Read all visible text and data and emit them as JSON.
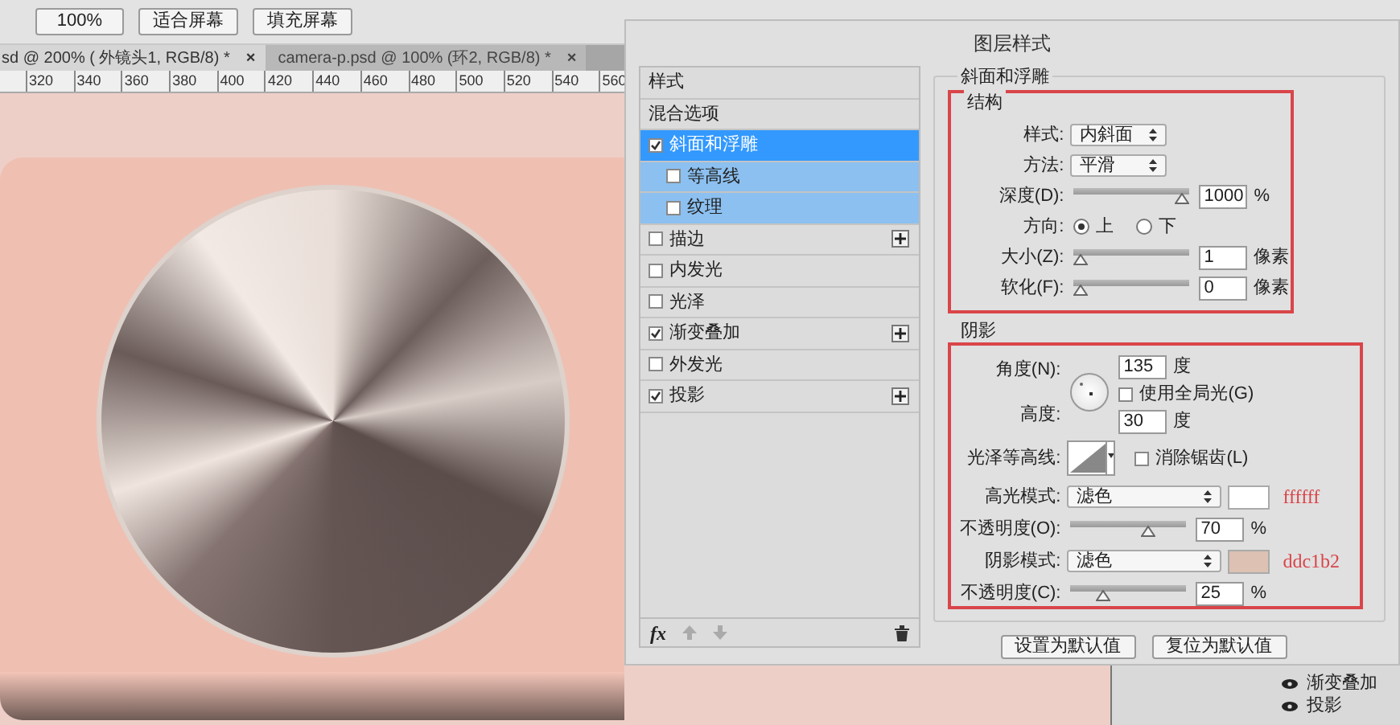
{
  "toolbar": {
    "buttons": [
      "100%",
      "适合屏幕",
      "填充屏幕"
    ]
  },
  "document_tabs": [
    {
      "label": "sd @ 200% ( 外镜头1, RGB/8) *",
      "close": "×",
      "selected": true
    },
    {
      "label": "camera-p.psd @ 100% (环2, RGB/8) *",
      "close": "×",
      "selected": false
    }
  ],
  "ruler": {
    "ticks": [
      "320",
      "340",
      "360",
      "380",
      "400",
      "420",
      "440",
      "460",
      "480",
      "500",
      "520",
      "540",
      "560"
    ]
  },
  "dialog": {
    "title": "图层样式",
    "styles_list": {
      "header": "样式",
      "blending": "混合选项",
      "items": [
        {
          "label": "斜面和浮雕",
          "checked": true,
          "selected": true,
          "kind": "effect",
          "add": false
        },
        {
          "label": "等高线",
          "checked": false,
          "selected": false,
          "kind": "sub",
          "add": false
        },
        {
          "label": "纹理",
          "checked": false,
          "selected": false,
          "kind": "sub",
          "add": false
        },
        {
          "label": "描边",
          "checked": false,
          "selected": false,
          "kind": "effect",
          "add": true
        },
        {
          "label": "内发光",
          "checked": false,
          "selected": false,
          "kind": "effect",
          "add": false
        },
        {
          "label": "光泽",
          "checked": false,
          "selected": false,
          "kind": "effect",
          "add": false
        },
        {
          "label": "渐变叠加",
          "checked": true,
          "selected": false,
          "kind": "effect",
          "add": true
        },
        {
          "label": "外发光",
          "checked": false,
          "selected": false,
          "kind": "effect",
          "add": false
        },
        {
          "label": "投影",
          "checked": true,
          "selected": false,
          "kind": "effect",
          "add": true
        }
      ],
      "footer_label": "fx"
    },
    "bevel": {
      "title": "斜面和浮雕",
      "structure_title": "结构",
      "style": {
        "label": "样式:",
        "value": "内斜面"
      },
      "method": {
        "label": "方法:",
        "value": "平滑"
      },
      "depth": {
        "label": "深度(D):",
        "level": 1.0,
        "value": "1000",
        "unit": "%"
      },
      "direction": {
        "label": "方向:",
        "options": [
          {
            "label": "上",
            "selected": true
          },
          {
            "label": "下",
            "selected": false
          }
        ]
      },
      "size": {
        "label": "大小(Z):",
        "level": 0.0,
        "value": "1",
        "unit": "像素"
      },
      "soften": {
        "label": "软化(F):",
        "level": 0.0,
        "value": "0",
        "unit": "像素"
      }
    },
    "shading": {
      "title": "阴影",
      "angle": {
        "label": "角度(N):",
        "value": "135",
        "unit": "度"
      },
      "global_light": {
        "label": "使用全局光(G)",
        "checked": false
      },
      "altitude": {
        "label": "高度:",
        "value": "30",
        "unit": "度"
      },
      "gloss_contour": {
        "label": "光泽等高线:"
      },
      "anti_alias": {
        "label": "消除锯齿(L)",
        "checked": false
      },
      "highlight_mode": {
        "label": "高光模式:",
        "value": "滤色",
        "color": "#ffffff",
        "note": "ffffff"
      },
      "highlight_opacity": {
        "label": "不透明度(O):",
        "level": 0.7,
        "value": "70",
        "unit": "%"
      },
      "shadow_mode": {
        "label": "阴影模式:",
        "value": "滤色",
        "color": "#ddc1b2",
        "note": "ddc1b2"
      },
      "shadow_opacity": {
        "label": "不透明度(C):",
        "level": 0.25,
        "value": "25",
        "unit": "%"
      }
    },
    "buttons": [
      "设置为默认值",
      "复位为默认值"
    ]
  },
  "layers_panel": {
    "effects": [
      "渐变叠加",
      "投影"
    ]
  }
}
